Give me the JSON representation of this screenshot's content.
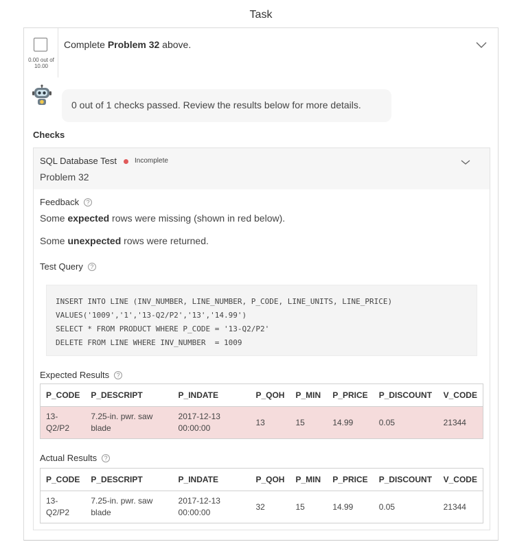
{
  "page": {
    "title": "Task"
  },
  "task": {
    "score": "0.00 out of 10.00",
    "prompt_prefix": "Complete ",
    "prompt_bold": "Problem 32",
    "prompt_suffix": " above.",
    "summary": "0 out of 1 checks passed. Review the results below for more details.",
    "checks_heading": "Checks"
  },
  "check": {
    "name": "SQL Database Test",
    "status": "Incomplete",
    "status_color": "#e05a5a",
    "subtitle": "Problem 32",
    "feedback_label": "Feedback",
    "feedback_1_prefix": "Some ",
    "feedback_1_bold": "expected",
    "feedback_1_suffix": " rows were missing (shown in red below).",
    "feedback_2_prefix": "Some ",
    "feedback_2_bold": "unexpected",
    "feedback_2_suffix": " rows were returned.",
    "query_label": "Test Query",
    "query": "INSERT INTO LINE (INV_NUMBER, LINE_NUMBER, P_CODE, LINE_UNITS, LINE_PRICE)\nVALUES('1009','1','13-Q2/P2','13','14.99')\nSELECT * FROM PRODUCT WHERE P_CODE = '13-Q2/P2'\nDELETE FROM LINE WHERE INV_NUMBER  = 1009"
  },
  "expected": {
    "label": "Expected Results",
    "columns": [
      "P_CODE",
      "P_DESCRIPT",
      "P_INDATE",
      "P_QOH",
      "P_MIN",
      "P_PRICE",
      "P_DISCOUNT",
      "V_CODE"
    ],
    "row": [
      "13-Q2/P2",
      "7.25-in. pwr. saw blade",
      "2017-12-13 00:00:00",
      "13",
      "15",
      "14.99",
      "0.05",
      "21344"
    ]
  },
  "actual": {
    "label": "Actual Results",
    "columns": [
      "P_CODE",
      "P_DESCRIPT",
      "P_INDATE",
      "P_QOH",
      "P_MIN",
      "P_PRICE",
      "P_DISCOUNT",
      "V_CODE"
    ],
    "row": [
      "13-Q2/P2",
      "7.25-in. pwr. saw blade",
      "2017-12-13 00:00:00",
      "32",
      "15",
      "14.99",
      "0.05",
      "21344"
    ]
  },
  "icons": {
    "checkbox": "checkbox-icon",
    "chevron": "chevron-down-icon",
    "bot": "robot-avatar-icon",
    "help": "help-circle-icon"
  }
}
